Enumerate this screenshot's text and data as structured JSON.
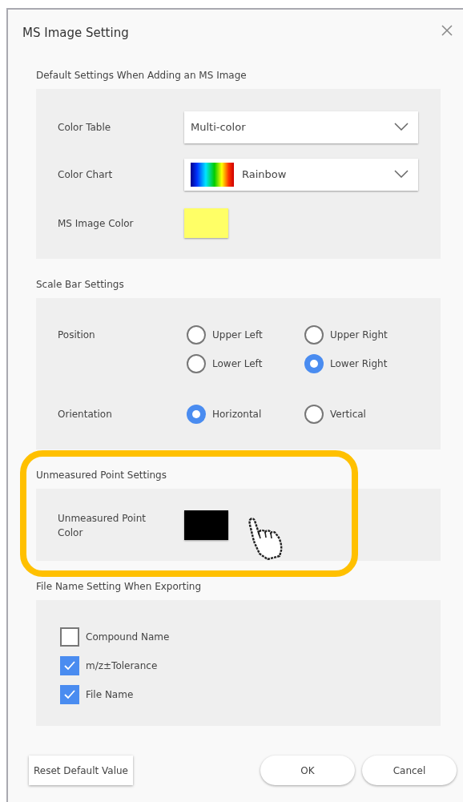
{
  "window": {
    "title": "MS Image Setting"
  },
  "sections": [
    {
      "kind": "fields",
      "title": "Default Settings When Adding an MS Image",
      "rows": [
        {
          "kind": "dropdown",
          "label": "Color Table",
          "value": "Multi-color"
        },
        {
          "kind": "gradient-dropdown",
          "label": "Color Chart",
          "value": "Rainbow"
        },
        {
          "kind": "swatch",
          "label": "MS Image Color",
          "color": "#ffff66"
        }
      ]
    },
    {
      "kind": "radios",
      "title": "Scale Bar Settings",
      "groups": [
        {
          "label": "Position",
          "options": [
            {
              "label": "Upper Left",
              "selected": false
            },
            {
              "label": "Upper Right",
              "selected": false
            },
            {
              "label": "Lower Left",
              "selected": false
            },
            {
              "label": "Lower Right",
              "selected": true
            }
          ]
        },
        {
          "label": "Orientation",
          "options": [
            {
              "label": "Horizontal",
              "selected": true
            },
            {
              "label": "Vertical",
              "selected": false
            }
          ]
        }
      ]
    },
    {
      "kind": "fields",
      "title": "Unmeasured Point Settings",
      "highlighted": true,
      "rows": [
        {
          "kind": "swatch",
          "label": "Unmeasured Point Color",
          "color": "#000000"
        }
      ]
    },
    {
      "kind": "checkboxes",
      "title": "File Name Setting When Exporting",
      "items": [
        {
          "label": "Compound Name",
          "checked": false
        },
        {
          "label": "m/z±Tolerance",
          "checked": true
        },
        {
          "label": "File Name",
          "checked": true
        }
      ]
    }
  ],
  "buttons": [
    {
      "kind": "square",
      "label": "Reset Default Value"
    },
    {
      "kind": "pill",
      "label": "OK"
    },
    {
      "kind": "pill",
      "label": "Cancel"
    }
  ]
}
